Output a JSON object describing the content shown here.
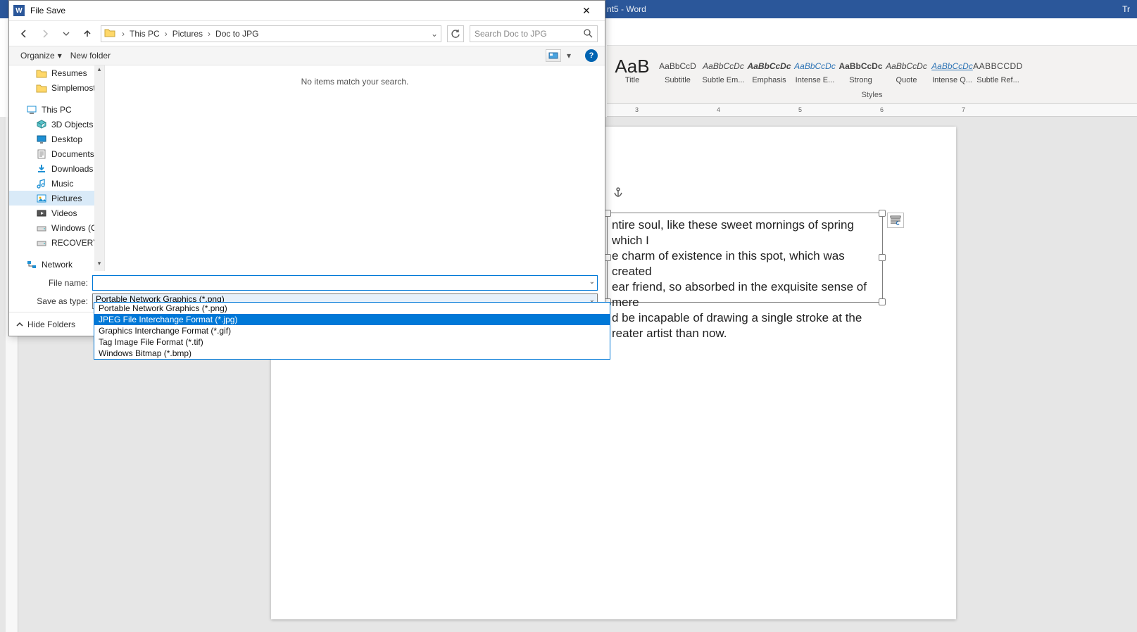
{
  "word": {
    "title_suffix": "nt5  -  Word",
    "title_right": "Tr",
    "styles_caption": "Styles",
    "styles": [
      {
        "sample": "AaB",
        "label": "Title",
        "cls": "first"
      },
      {
        "sample": "AaBbCcD",
        "label": "Subtitle",
        "cls": ""
      },
      {
        "sample": "AaBbCcDc",
        "label": "Subtle Em...",
        "cls": "italic"
      },
      {
        "sample": "AaBbCcDc",
        "label": "Emphasis",
        "cls": "italic bold"
      },
      {
        "sample": "AaBbCcDc",
        "label": "Intense E...",
        "cls": "italic blue"
      },
      {
        "sample": "AaBbCcDc",
        "label": "Strong",
        "cls": "bold"
      },
      {
        "sample": "AaBbCcDc",
        "label": "Quote",
        "cls": "italic"
      },
      {
        "sample": "AaBbCcDc",
        "label": "Intense Q...",
        "cls": "italic blue ul"
      },
      {
        "sample": "AABBCCDD",
        "label": "Subtle Ref...",
        "cls": "sc"
      }
    ],
    "ruler_marks": [
      "3",
      "4",
      "5",
      "6",
      "7"
    ],
    "text_lines": [
      "ntire soul, like these sweet mornings of spring which I",
      "e charm of existence in this spot, which was created",
      "ear friend, so absorbed in the exquisite sense of mere",
      "d be incapable of drawing a single stroke at the",
      "reater artist than now."
    ]
  },
  "dialog": {
    "title": "File Save",
    "breadcrumbs": [
      "This PC",
      "Pictures",
      "Doc to JPG"
    ],
    "search_placeholder": "Search Doc to JPG",
    "toolbar": {
      "organize": "Organize",
      "newfolder": "New folder"
    },
    "tree": {
      "quick": [
        {
          "label": "Resumes",
          "icon": "folder"
        },
        {
          "label": "Simplemost",
          "icon": "folder"
        }
      ],
      "thispc_label": "This PC",
      "thispc_items": [
        {
          "label": "3D Objects",
          "icon": "3d"
        },
        {
          "label": "Desktop",
          "icon": "desktop"
        },
        {
          "label": "Documents",
          "icon": "doc"
        },
        {
          "label": "Downloads",
          "icon": "download"
        },
        {
          "label": "Music",
          "icon": "music"
        },
        {
          "label": "Pictures",
          "icon": "pictures",
          "selected": true
        },
        {
          "label": "Videos",
          "icon": "video"
        },
        {
          "label": "Windows (C:)",
          "icon": "drive"
        },
        {
          "label": "RECOVERY (D:)",
          "icon": "drive"
        }
      ],
      "network_label": "Network"
    },
    "content_empty": "No items match your search.",
    "filename_label": "File name:",
    "filename_value": "",
    "saveastype_label": "Save as type:",
    "saveastype_value": "Portable Network Graphics (*.png)",
    "type_options": [
      "Portable Network Graphics (*.png)",
      "JPEG File Interchange Format (*.jpg)",
      "Graphics Interchange Format (*.gif)",
      "Tag Image File Format (*.tif)",
      "Windows Bitmap (*.bmp)"
    ],
    "type_highlight_index": 1,
    "hide_folders": "Hide Folders"
  }
}
